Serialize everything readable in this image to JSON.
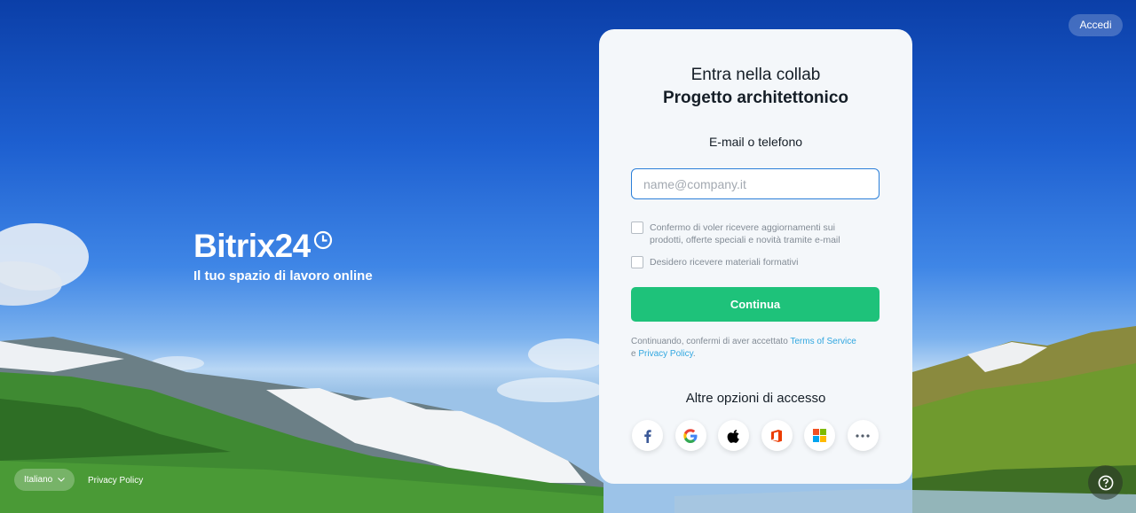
{
  "header": {
    "signin_label": "Accedi"
  },
  "brand": {
    "name": "Bitrix24",
    "tagline": "Il tuo spazio di lavoro online"
  },
  "card": {
    "title_line1": "Entra nella collab",
    "title_line2": "Progetto architettonico",
    "field_label": "E-mail o telefono",
    "email_value": "",
    "email_placeholder": "name@company.it",
    "checkbox_updates": {
      "label": "Confermo di voler ricevere aggiornamenti sui prodotti, offerte speciali e novità tramite e-mail",
      "checked": false
    },
    "checkbox_training": {
      "label": "Desidero ricevere materiali formativi",
      "checked": false
    },
    "continue_label": "Continua",
    "terms_prefix": "Continuando, confermi di aver accettato ",
    "terms_link": "Terms of Service",
    "terms_join": "e ",
    "privacy_link": "Privacy Policy",
    "terms_suffix": ".",
    "alt_title": "Altre opzioni di accesso",
    "social_providers": [
      "facebook-icon",
      "google-icon",
      "apple-icon",
      "office-icon",
      "microsoft-icon",
      "more-icon"
    ]
  },
  "footer": {
    "language": "Italiano",
    "privacy_label": "Privacy Policy"
  },
  "colors": {
    "accent_green": "#1ec27a",
    "link_blue": "#31a7e0",
    "input_border": "#2b7fd9"
  }
}
